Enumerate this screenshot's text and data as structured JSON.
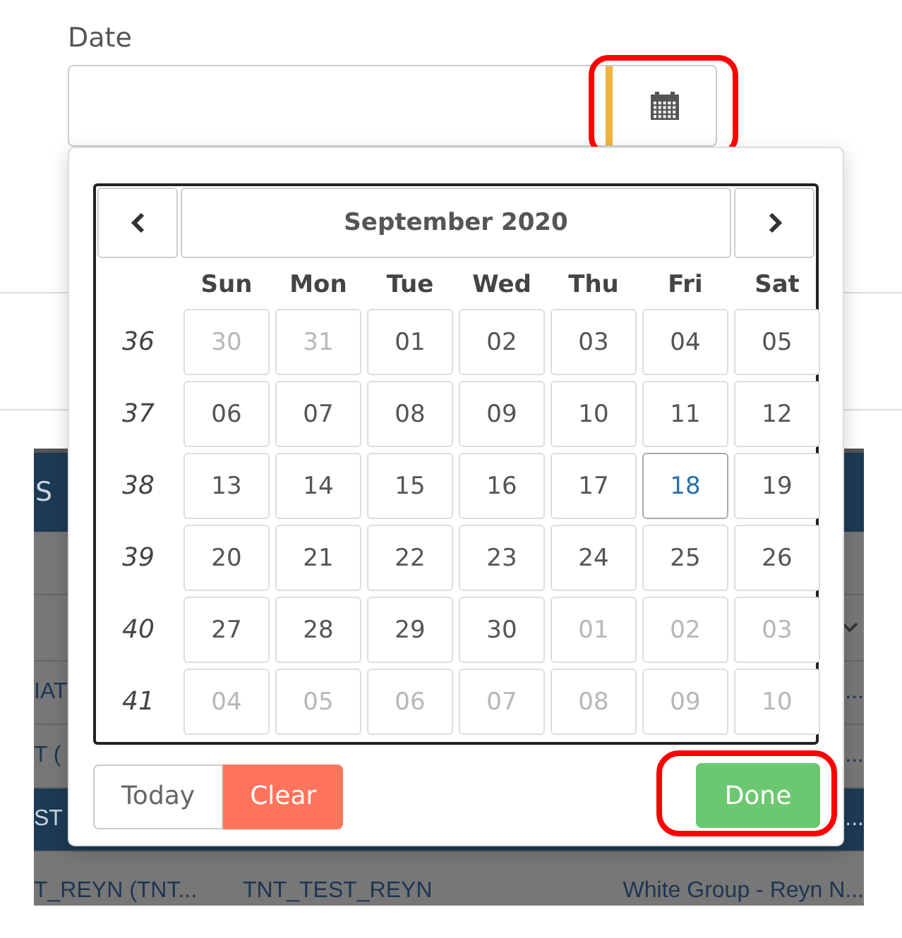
{
  "field": {
    "label": "Date",
    "calendar_button": {
      "highlighted": true
    }
  },
  "background_table": {
    "header": "S",
    "rows": [
      {
        "kind": "spacer",
        "selected": false
      },
      {
        "kind": "select",
        "selected": false
      },
      {
        "kind": "data",
        "selected": false,
        "column_1": "IAT",
        "column_3": "..."
      },
      {
        "kind": "data",
        "selected": false,
        "column_1": "T (",
        "column_3": "..."
      },
      {
        "kind": "data",
        "selected": true,
        "column_1": "ST",
        "column_3": "..."
      },
      {
        "kind": "data",
        "selected": false,
        "column_1": "T_REYN (TNT...",
        "column_2": "TNT_TEST_REYN",
        "column_3": "White Group - Reyn N..."
      }
    ]
  },
  "datepicker": {
    "title": "September 2020",
    "weekdays": [
      "Sun",
      "Mon",
      "Tue",
      "Wed",
      "Thu",
      "Fri",
      "Sat"
    ],
    "weeks": [
      {
        "number": "36",
        "days": [
          {
            "label": "30",
            "muted": true,
            "today": false
          },
          {
            "label": "31",
            "muted": true,
            "today": false
          },
          {
            "label": "01",
            "muted": false,
            "today": false
          },
          {
            "label": "02",
            "muted": false,
            "today": false
          },
          {
            "label": "03",
            "muted": false,
            "today": false
          },
          {
            "label": "04",
            "muted": false,
            "today": false
          },
          {
            "label": "05",
            "muted": false,
            "today": false
          }
        ]
      },
      {
        "number": "37",
        "days": [
          {
            "label": "06",
            "muted": false,
            "today": false
          },
          {
            "label": "07",
            "muted": false,
            "today": false
          },
          {
            "label": "08",
            "muted": false,
            "today": false
          },
          {
            "label": "09",
            "muted": false,
            "today": false
          },
          {
            "label": "10",
            "muted": false,
            "today": false
          },
          {
            "label": "11",
            "muted": false,
            "today": false
          },
          {
            "label": "12",
            "muted": false,
            "today": false
          }
        ]
      },
      {
        "number": "38",
        "days": [
          {
            "label": "13",
            "muted": false,
            "today": false
          },
          {
            "label": "14",
            "muted": false,
            "today": false
          },
          {
            "label": "15",
            "muted": false,
            "today": false
          },
          {
            "label": "16",
            "muted": false,
            "today": false
          },
          {
            "label": "17",
            "muted": false,
            "today": false
          },
          {
            "label": "18",
            "muted": false,
            "today": true
          },
          {
            "label": "19",
            "muted": false,
            "today": false
          }
        ]
      },
      {
        "number": "39",
        "days": [
          {
            "label": "20",
            "muted": false,
            "today": false
          },
          {
            "label": "21",
            "muted": false,
            "today": false
          },
          {
            "label": "22",
            "muted": false,
            "today": false
          },
          {
            "label": "23",
            "muted": false,
            "today": false
          },
          {
            "label": "24",
            "muted": false,
            "today": false
          },
          {
            "label": "25",
            "muted": false,
            "today": false
          },
          {
            "label": "26",
            "muted": false,
            "today": false
          }
        ]
      },
      {
        "number": "40",
        "days": [
          {
            "label": "27",
            "muted": false,
            "today": false
          },
          {
            "label": "28",
            "muted": false,
            "today": false
          },
          {
            "label": "29",
            "muted": false,
            "today": false
          },
          {
            "label": "30",
            "muted": false,
            "today": false
          },
          {
            "label": "01",
            "muted": true,
            "today": false
          },
          {
            "label": "02",
            "muted": true,
            "today": false
          },
          {
            "label": "03",
            "muted": true,
            "today": false
          }
        ]
      },
      {
        "number": "41",
        "days": [
          {
            "label": "04",
            "muted": true,
            "today": false
          },
          {
            "label": "05",
            "muted": true,
            "today": false
          },
          {
            "label": "06",
            "muted": true,
            "today": false
          },
          {
            "label": "07",
            "muted": true,
            "today": false
          },
          {
            "label": "08",
            "muted": true,
            "today": false
          },
          {
            "label": "09",
            "muted": true,
            "today": false
          },
          {
            "label": "10",
            "muted": true,
            "today": false
          }
        ]
      }
    ],
    "buttons": [
      {
        "label": "Today",
        "kind": "default",
        "highlighted": false
      },
      {
        "label": "Clear",
        "kind": "danger",
        "highlighted": false
      },
      {
        "label": "Done",
        "kind": "success",
        "highlighted": true
      }
    ]
  }
}
